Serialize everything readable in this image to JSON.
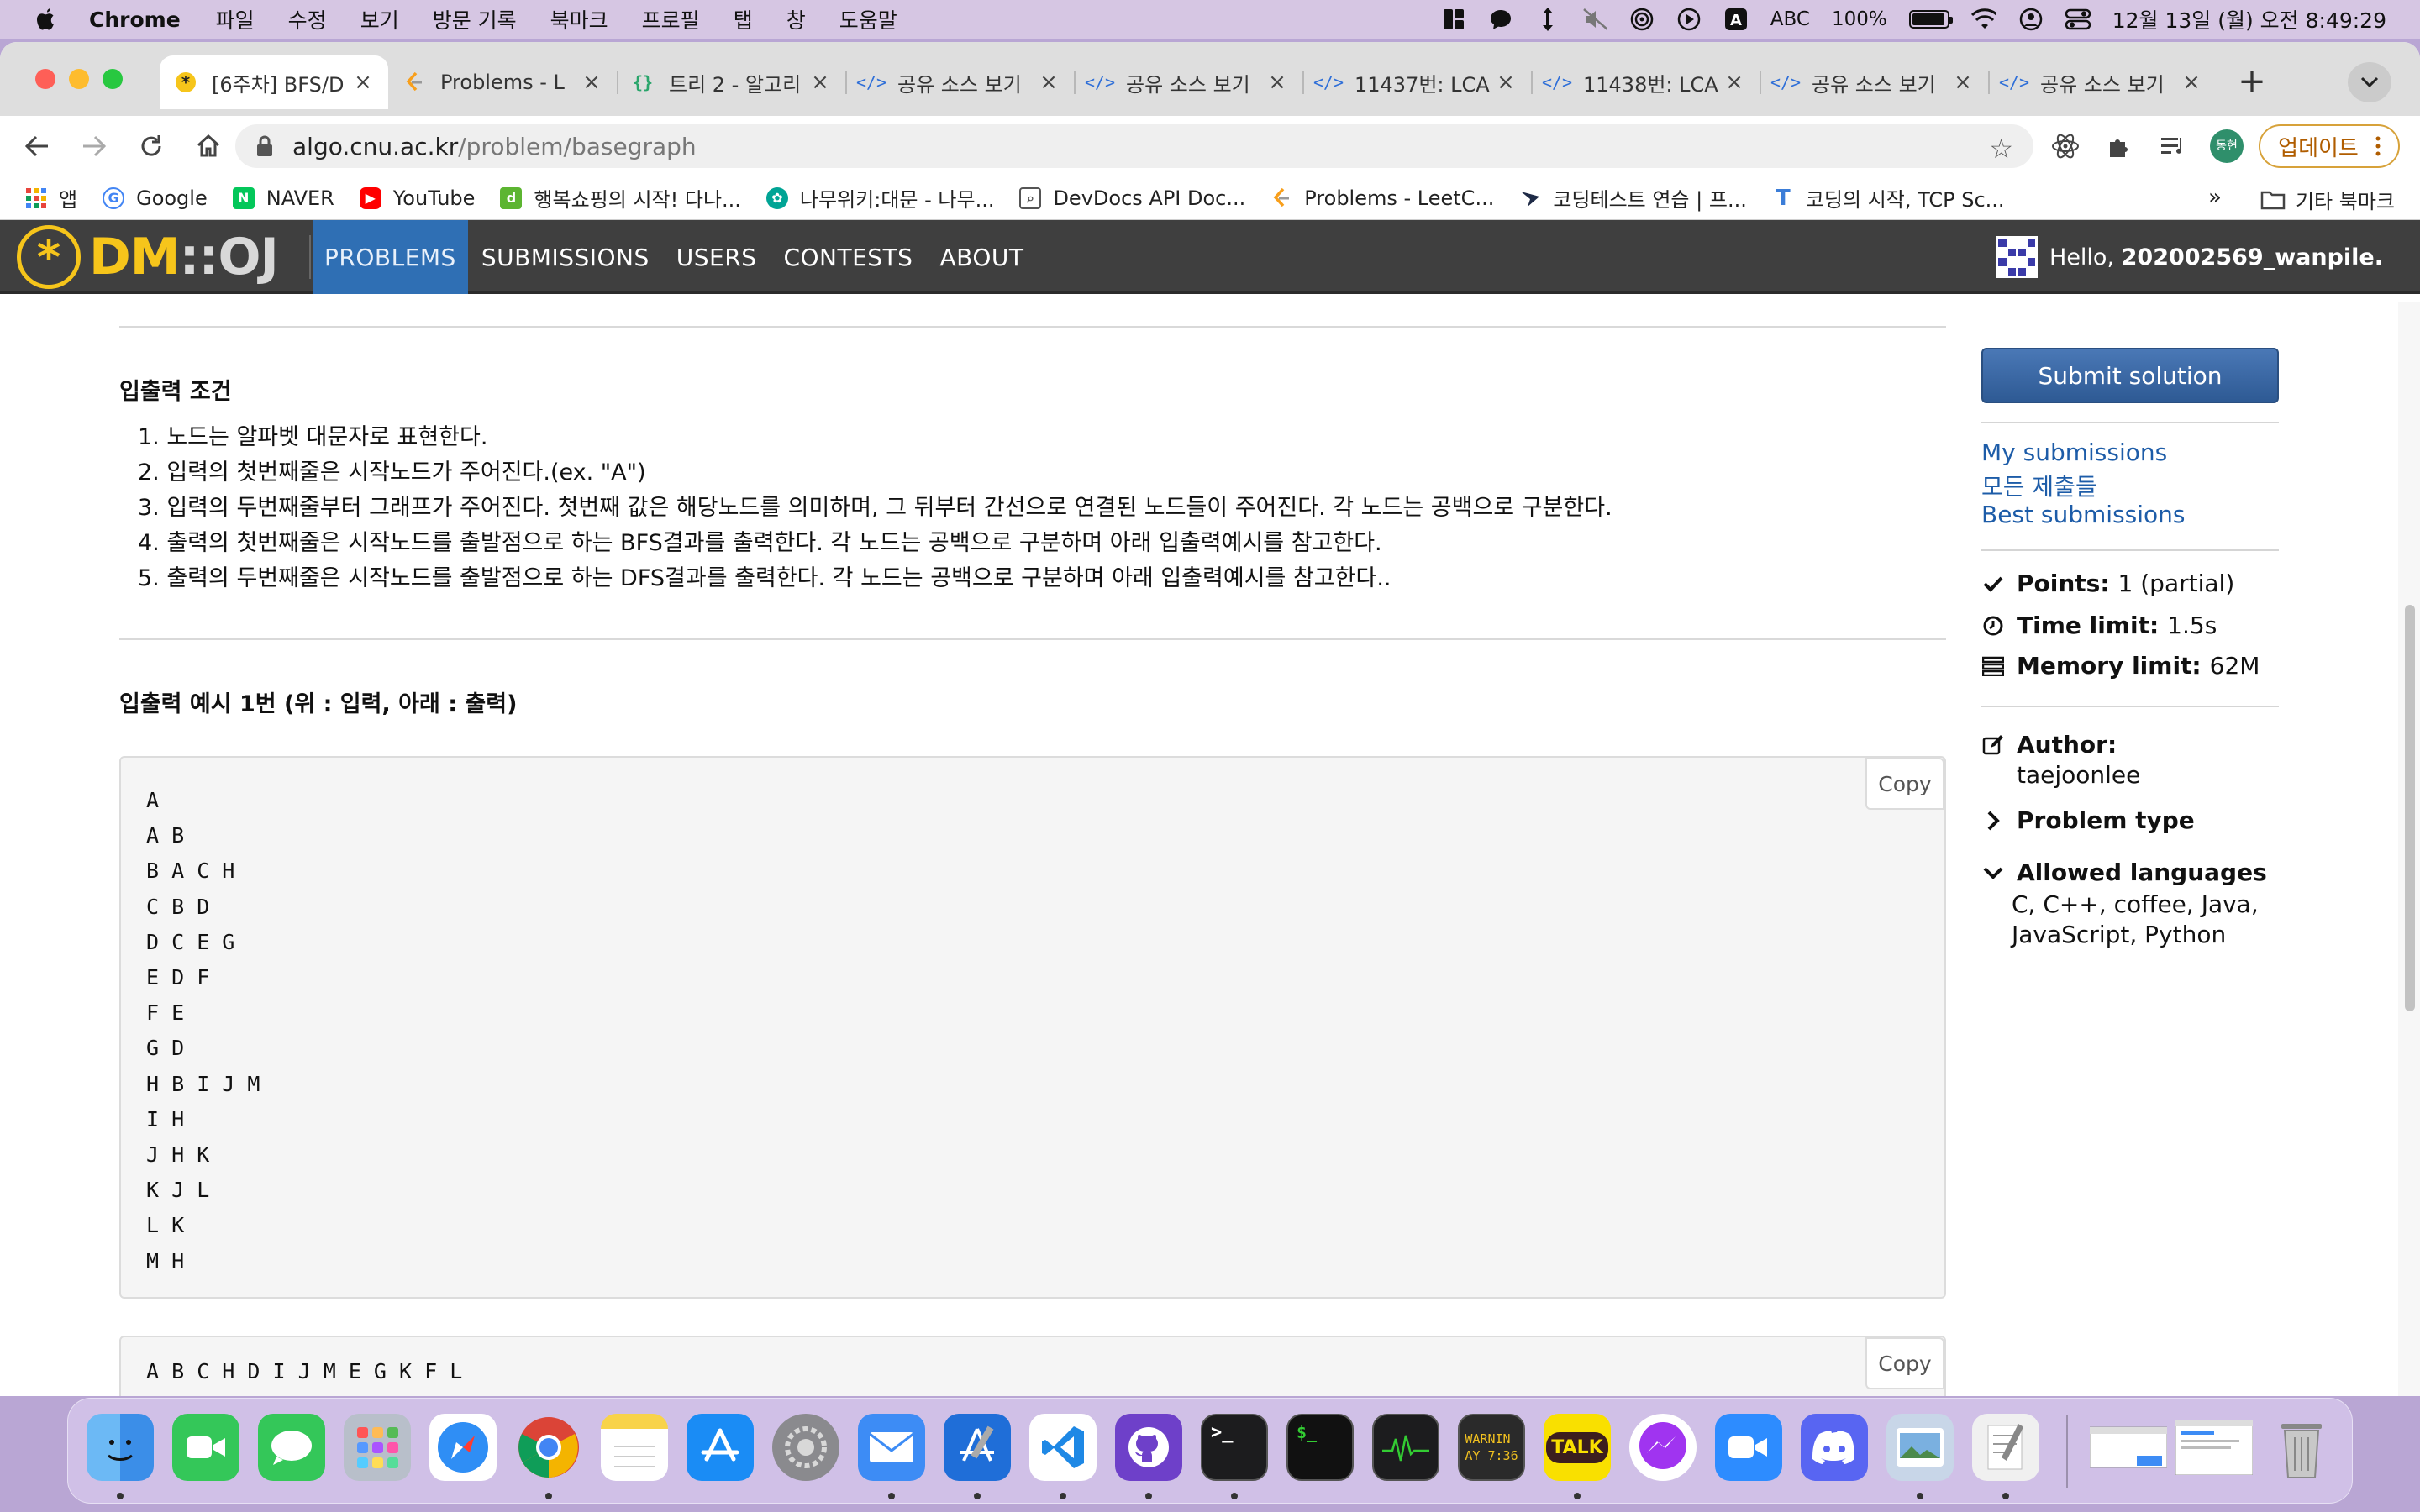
{
  "menubar": {
    "app_name": "Chrome",
    "menus": [
      "파일",
      "수정",
      "보기",
      "방문 기록",
      "북마크",
      "프로필",
      "탭",
      "창",
      "도움말"
    ],
    "input_source": "ABC",
    "battery": "100%",
    "datetime": "12월 13일 (월) 오전 8:49:29"
  },
  "browser": {
    "tabs": [
      {
        "title": "[6주차] BFS/D",
        "icon": "dmoj-favicon",
        "active": true
      },
      {
        "title": "Problems - L",
        "icon": "leetcode-favicon"
      },
      {
        "title": "트리 2 - 알고리",
        "icon": "curly-braces-favicon"
      },
      {
        "title": "공유 소스 보기",
        "icon": "code-favicon"
      },
      {
        "title": "공유 소스 보기",
        "icon": "code-favicon"
      },
      {
        "title": "11437번: LCA",
        "icon": "code-favicon"
      },
      {
        "title": "11438번: LCA",
        "icon": "code-favicon"
      },
      {
        "title": "공유 소스 보기",
        "icon": "code-favicon"
      },
      {
        "title": "공유 소스 보기",
        "icon": "code-favicon"
      }
    ],
    "address": {
      "domain": "algo.cnu.ac.kr",
      "path": "/problem/basegraph"
    },
    "profile_initials": "동현",
    "update_label": "업데이트",
    "bookmarks": [
      {
        "label": "앱",
        "icon": "apps-grid-icon",
        "color": "#e8453c"
      },
      {
        "label": "Google",
        "icon": "google-icon",
        "color": "#4285f4"
      },
      {
        "label": "NAVER",
        "icon": "naver-icon",
        "color": "#03c75a"
      },
      {
        "label": "YouTube",
        "icon": "youtube-icon",
        "color": "#ff0000"
      },
      {
        "label": "행복쇼핑의 시작! 다나...",
        "icon": "danawa-icon",
        "color": "#5cb531"
      },
      {
        "label": "나무위키:대문 - 나무...",
        "icon": "namuwiki-icon",
        "color": "#00a495"
      },
      {
        "label": "DevDocs API Doc...",
        "icon": "devdocs-icon",
        "color": "#555555"
      },
      {
        "label": "Problems - LeetC...",
        "icon": "leetcode-icon",
        "color": "#f89f1b"
      },
      {
        "label": "코딩테스트 연습 | 프...",
        "icon": "programmers-icon",
        "color": "#1e2a46"
      },
      {
        "label": "코딩의 시작, TCP Sc...",
        "icon": "tcpschool-icon",
        "color": "#3b7dd8"
      }
    ],
    "bookmarks_more": "»",
    "other_bookmarks": "기타 북마크"
  },
  "site": {
    "logo": {
      "dm": "DM",
      "sep": "::",
      "oj": "OJ"
    },
    "nav": [
      "PROBLEMS",
      "SUBMISSIONS",
      "USERS",
      "CONTESTS",
      "ABOUT"
    ],
    "active_nav": "PROBLEMS",
    "user_greeting": "Hello, ",
    "username": "202002569_wanpile."
  },
  "problem": {
    "io_heading": "입출력 조건",
    "rules": [
      "1. 노드는 알파벳 대문자로 표현한다.",
      "2. 입력의 첫번째줄은 시작노드가 주어진다.(ex. \"A\")",
      "3. 입력의 두번째줄부터 그래프가 주어진다. 첫번째 값은 해당노드를 의미하며, 그 뒤부터 간선으로 연결된 노드들이 주어진다. 각 노드는 공백으로 구분한다.",
      "4. 출력의 첫번째줄은 시작노드를 출발점으로 하는 BFS결과를 출력한다. 각 노드는 공백으로 구분하며 아래 입출력예시를 참고한다.",
      "5. 출력의 두번째줄은 시작노드를 출발점으로 하는 DFS결과를 출력한다. 각 노드는 공백으로 구분하며 아래 입출력예시를 참고한다.."
    ],
    "example_heading": "입출력 예시 1번 (위 : 입력, 아래 : 출력)",
    "example_input": "A\nA B\nB A C H\nC B D\nD C E G\nE D F\nF E\nG D\nH B I J M\nI H\nJ H K\nK J L\nL K\nM H",
    "example_output": "A B C H D I J M E G K F L",
    "copy_label": "Copy"
  },
  "sidebar": {
    "submit_label": "Submit solution",
    "links": [
      "My submissions",
      "모든 제출들",
      "Best submissions"
    ],
    "points_label": "Points:",
    "points_value": "1 (partial)",
    "time_label": "Time limit:",
    "time_value": "1.5s",
    "memory_label": "Memory limit:",
    "memory_value": "62M",
    "author_label": "Author:",
    "author_value": "taejoonlee",
    "problem_type_label": "Problem type",
    "languages_label": "Allowed languages",
    "languages_line1": "C, C++, coffee, Java,",
    "languages_line2": "JavaScript, Python",
    "link_color": "#1d5ca8"
  },
  "dock": {
    "apps": [
      {
        "name": "finder-icon",
        "color": "#3e9af0"
      },
      {
        "name": "facetime-icon",
        "color": "#34c759"
      },
      {
        "name": "messages-icon",
        "color": "#34c759"
      },
      {
        "name": "launchpad-icon",
        "color": "#9aa6b8"
      },
      {
        "name": "safari-icon",
        "color": "#2f8ef5"
      },
      {
        "name": "chrome-icon",
        "color": "#eeeeee"
      },
      {
        "name": "notes-icon",
        "color": "#f8d34a"
      },
      {
        "name": "app-store-icon",
        "color": "#1a8cf5"
      },
      {
        "name": "system-preferences-icon",
        "color": "#8a8a8e"
      },
      {
        "name": "mail-icon",
        "color": "#3d8cf5"
      },
      {
        "name": "xcode-icon",
        "color": "#1f6ed8"
      },
      {
        "name": "vscode-icon",
        "color": "#ffffff"
      },
      {
        "name": "github-desktop-icon",
        "color": "#6e40c9"
      },
      {
        "name": "terminal-icon",
        "color": "#1c1c1e"
      },
      {
        "name": "iterm-icon",
        "color": "#111111"
      },
      {
        "name": "activity-monitor-icon",
        "color": "#1c1c1e"
      },
      {
        "name": "console-icon",
        "color": "#2a2a2a"
      },
      {
        "name": "kakaotalk-icon",
        "color": "#f9e000"
      },
      {
        "name": "messenger-icon",
        "color": "#a034f0"
      },
      {
        "name": "zoom-icon",
        "color": "#2d8cff"
      },
      {
        "name": "discord-icon",
        "color": "#5865f2"
      },
      {
        "name": "preview-icon",
        "color": "#c8d6e8"
      },
      {
        "name": "textedit-icon",
        "color": "#f0f0f0"
      }
    ],
    "console_text": "WARNIN\nAY 7:36",
    "kakaotalk_text": "TALK"
  }
}
